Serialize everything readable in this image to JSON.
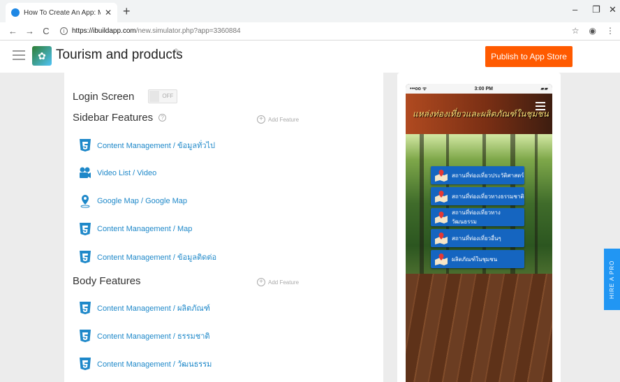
{
  "browser": {
    "tab_title": "How To Create An App: Make Yo",
    "tab_close": "✕",
    "new_tab": "+",
    "url_host": "https://ibuildapp.com",
    "url_path": "/new.simulator.php?app=3360884",
    "controls": {
      "minimize": "–",
      "maximize": "❐",
      "close": "✕"
    },
    "nav": {
      "back": "←",
      "forward": "→",
      "reload": "C"
    },
    "icons": [
      "star-icon",
      "account-icon",
      "menu-dots-icon"
    ]
  },
  "header": {
    "app_title": "Tourism and products",
    "publish_label": "Publish to App Store"
  },
  "settings": {
    "login_label": "Login Screen",
    "login_toggle": "OFF",
    "sidebar_title": "Sidebar Features",
    "body_title": "Body Features",
    "add_feature_label": "Add Feature"
  },
  "sidebar_features": [
    {
      "label": "Content Management / ข้อมูลทั่วไป",
      "icon": "html5-icon"
    },
    {
      "label": "Video List / Video",
      "icon": "video-icon"
    },
    {
      "label": "Google Map / Google Map",
      "icon": "map-pin-icon"
    },
    {
      "label": "Content Management / Map",
      "icon": "html5-icon"
    },
    {
      "label": "Content Management / ข้อมูลติดต่อ",
      "icon": "html5-icon"
    }
  ],
  "body_features": [
    {
      "label": "Content Management / ผลิตภัณฑ์",
      "icon": "html5-icon"
    },
    {
      "label": "Content Management / ธรรมชาติ",
      "icon": "html5-icon"
    },
    {
      "label": "Content Management / วัฒนธรรม",
      "icon": "html5-icon"
    }
  ],
  "phone": {
    "carrier": "•••oo ᯤ",
    "time": "3:00 PM",
    "battery": "▰▰",
    "header_text": "แหล่งท่องเที่ยวและผลิตภัณฑ์ในชุมชน",
    "buttons": [
      "สถานที่ท่องเที่ยวประวัติศาสตร์",
      "สถานที่ท่องเที่ยวทางธรรมชาติ",
      "สถานที่ท่องเที่ยวทางวัฒนธรรม",
      "สถานที่ท่องเที่ยวอื่นๆ",
      "ผลิตภัณฑ์ในชุมชน"
    ]
  },
  "hire_pro_label": "HIRE A PRO",
  "colors": {
    "publish": "#ff5a00",
    "link": "#1e88c9",
    "phone_button": "#1565c0",
    "hire_tab": "#2196f3"
  }
}
